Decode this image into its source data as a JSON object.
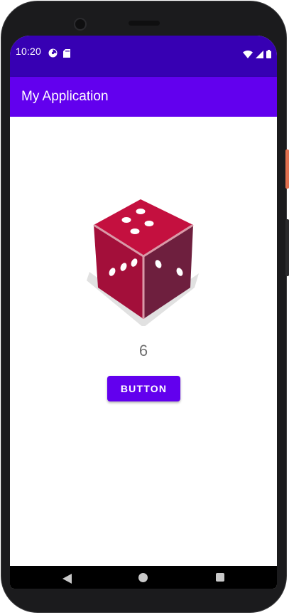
{
  "status_bar": {
    "time": "10:20",
    "left_icons": [
      "pie-status-icon",
      "sd-card-icon"
    ],
    "right_icons": [
      "wifi-icon",
      "signal-icon",
      "battery-icon"
    ]
  },
  "app_bar": {
    "title": "My Application"
  },
  "main": {
    "dice_image": {
      "icon": "dice-icon",
      "value_shown": 6,
      "colors": {
        "top": "#c4103f",
        "left": "#a30f3a",
        "right": "#6e1f3e",
        "edge": "#d99aa8",
        "pip": "#ffffff",
        "shadow": "#e1e1e1"
      }
    },
    "result_text": "6",
    "roll_button_label": "BUTTON"
  },
  "nav_bar": {
    "icons": [
      "back-icon",
      "home-icon",
      "recent-apps-icon"
    ]
  },
  "colors": {
    "status_bar": "#3700b3",
    "app_bar": "#6200ee",
    "button": "#6200ee",
    "result_text": "#707070"
  }
}
